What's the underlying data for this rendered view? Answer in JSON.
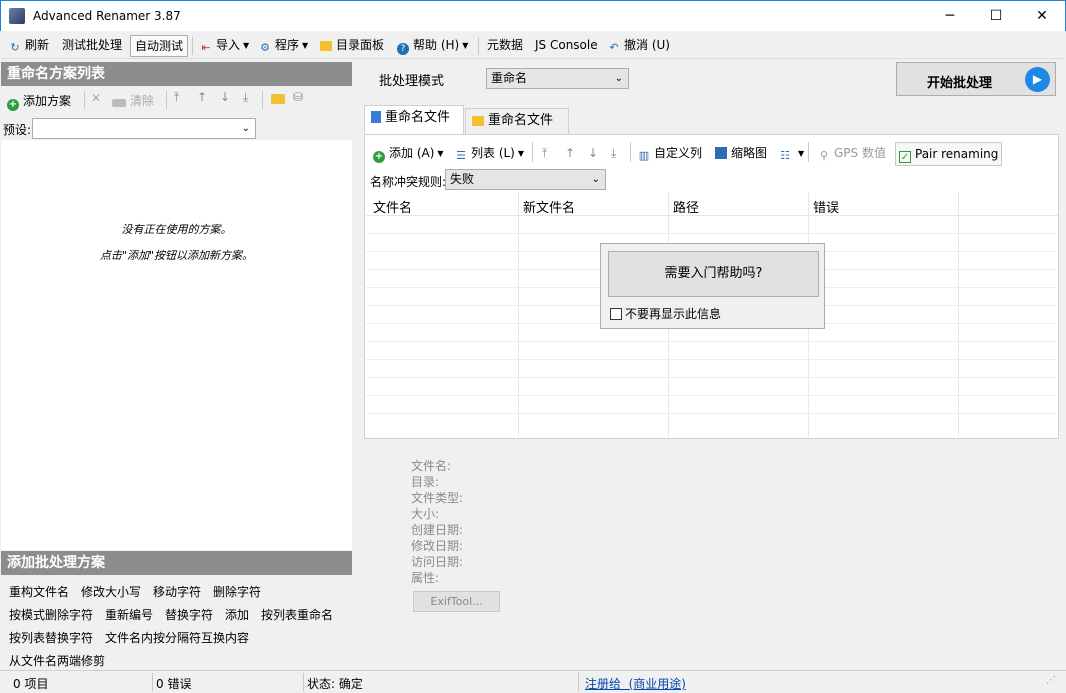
{
  "window": {
    "title": "Advanced Renamer 3.87",
    "minimize": "─",
    "maximize": "☐",
    "close": "✕"
  },
  "toolbar": {
    "refresh": "刷新",
    "test_batch": "测试批处理",
    "auto_test": "自动测试",
    "import": "导入",
    "program": "程序",
    "dir_panel": "目录面板",
    "help": "帮助 (H)",
    "metadata": "元数据",
    "js_console": "JS Console",
    "undo": "撤消 (U)"
  },
  "left_panel": {
    "title": "重命名方案列表",
    "add_method": "添加方案",
    "clear": "清除",
    "preset_label": "预设:",
    "preset_value": "",
    "empty_line1": "没有正在使用的方案。",
    "empty_line2": "点击\"添加\"按钮以添加新方案。"
  },
  "add_panel": {
    "title": "添加批处理方案",
    "methods": [
      "重构文件名",
      "修改大小写",
      "移动字符",
      "删除字符",
      "按模式删除字符",
      "重新编号",
      "替换字符",
      "添加",
      "按列表重命名",
      "按列表替换字符",
      "文件名内按分隔符互换内容",
      "从文件名两端修剪"
    ]
  },
  "main": {
    "batch_mode_label": "批处理模式",
    "batch_mode_value": "重命名",
    "start_batch": "开始批处理",
    "tabs": [
      "重命名文件",
      "重命名文件夹"
    ],
    "files_toolbar": {
      "add": "添加 (A)",
      "list": "列表 (L)",
      "custom_columns": "自定义列",
      "thumbnails": "缩略图",
      "gps": "GPS 数值",
      "pair_renaming": "Pair renaming"
    },
    "conflict_label": "名称冲突规则:",
    "conflict_value": "失败",
    "columns": [
      "文件名",
      "新文件名",
      "路径",
      "错误"
    ],
    "help_popup": {
      "button": "需要入门帮助吗?",
      "checkbox": "不要再显示此信息"
    },
    "info_labels": [
      "文件名:",
      "目录:",
      "文件类型:",
      "大小:",
      "创建日期:",
      "修改日期:",
      "访问日期:",
      "属性:"
    ],
    "exiftool": "ExifTool..."
  },
  "statusbar": {
    "items": "0 项目",
    "errors": "0 错误",
    "status": "状态: 确定",
    "register": "注册给  (商业用途)"
  },
  "colors": {
    "accent": "#1883d7",
    "panel_header": "#8d8d8d",
    "start_icon": "#1e88e5"
  }
}
